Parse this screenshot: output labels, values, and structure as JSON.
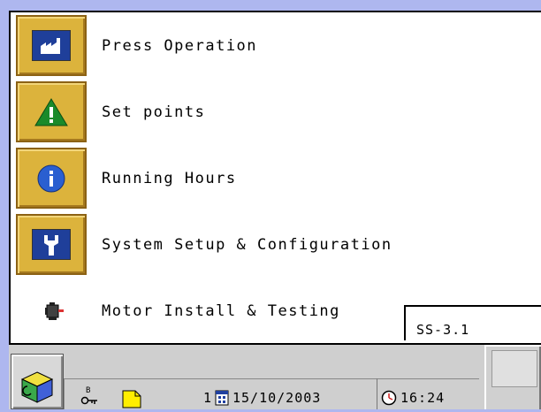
{
  "menu": {
    "items": [
      {
        "label": "Press Operation",
        "icon": "factory-icon"
      },
      {
        "label": "Set points",
        "icon": "warning-triangle-icon"
      },
      {
        "label": "Running Hours",
        "icon": "info-icon"
      },
      {
        "label": "System Setup & Configuration",
        "icon": "wrench-icon"
      },
      {
        "label": "Motor Install & Testing",
        "icon": "motor-icon"
      }
    ]
  },
  "screen_code": "SS-3.1",
  "status_bar": {
    "page_number": "1",
    "date": "15/10/2003",
    "time": "16:24"
  },
  "colors": {
    "background": "#aeb7ef",
    "tile": "#dcb33c",
    "panel": "#ffffff",
    "bar": "#cfcfcf"
  }
}
